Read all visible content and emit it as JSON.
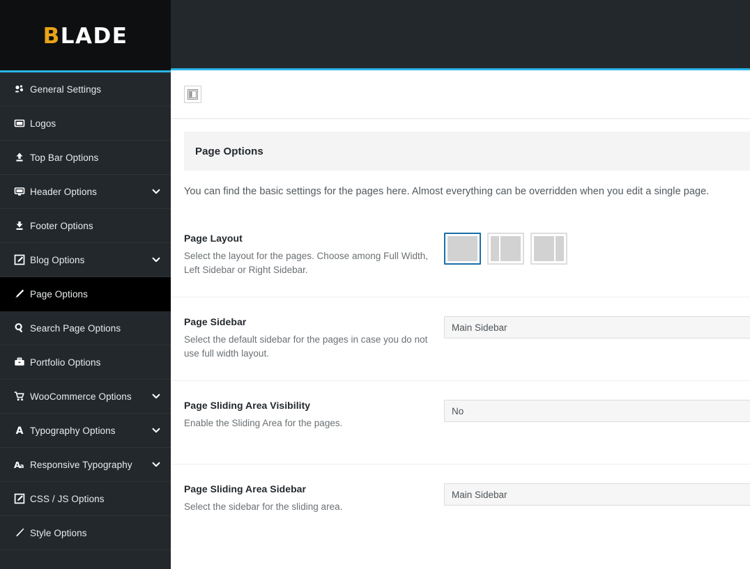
{
  "brand": {
    "logo_first": "B",
    "logo_rest": "LADE",
    "accent_color": "#29b6e8",
    "logo_accent_color": "#e8a317"
  },
  "sidebar": {
    "items": [
      {
        "label": "General Settings",
        "icon": "sliders-icon",
        "expandable": false,
        "active": false
      },
      {
        "label": "Logos",
        "icon": "image-icon",
        "expandable": false,
        "active": false
      },
      {
        "label": "Top Bar Options",
        "icon": "arrow-up-icon",
        "expandable": false,
        "active": false
      },
      {
        "label": "Header Options",
        "icon": "monitor-icon",
        "expandable": true,
        "active": false
      },
      {
        "label": "Footer Options",
        "icon": "arrow-down-icon",
        "expandable": false,
        "active": false
      },
      {
        "label": "Blog Options",
        "icon": "edit-square-icon",
        "expandable": true,
        "active": false
      },
      {
        "label": "Page Options",
        "icon": "pencil-icon",
        "expandable": false,
        "active": true
      },
      {
        "label": "Search Page Options",
        "icon": "search-icon",
        "expandable": false,
        "active": false
      },
      {
        "label": "Portfolio Options",
        "icon": "briefcase-icon",
        "expandable": false,
        "active": false
      },
      {
        "label": "WooCommerce Options",
        "icon": "cart-icon",
        "expandable": true,
        "active": false
      },
      {
        "label": "Typography Options",
        "icon": "letter-a-icon",
        "expandable": true,
        "active": false
      },
      {
        "label": "Responsive Typography",
        "icon": "letter-aa-icon",
        "expandable": true,
        "active": false
      },
      {
        "label": "CSS / JS Options",
        "icon": "code-edit-icon",
        "expandable": false,
        "active": false
      },
      {
        "label": "Style Options",
        "icon": "brush-icon",
        "expandable": false,
        "active": false
      }
    ]
  },
  "toolbar": {
    "layout_toggle_icon": "sidebar-layout-icon"
  },
  "panel": {
    "title": "Page Options",
    "description": "You can find the basic settings for the pages here. Almost everything can be overridden when you edit a single page."
  },
  "fields": [
    {
      "title": "Page Layout",
      "subtitle": "Select the layout for the pages. Choose among Full Width, Left Sidebar or Right Sidebar.",
      "control": "layout-picker",
      "options": [
        {
          "name": "full-width",
          "selected": true
        },
        {
          "name": "left-sidebar",
          "selected": false
        },
        {
          "name": "right-sidebar",
          "selected": false
        }
      ]
    },
    {
      "title": "Page Sidebar",
      "subtitle": "Select the default sidebar for the pages in case you do not use full width layout.",
      "control": "select",
      "value": "Main Sidebar"
    },
    {
      "title": "Page Sliding Area Visibility",
      "subtitle": "Enable the Sliding Area for the pages.",
      "control": "select",
      "value": "No"
    },
    {
      "title": "Page Sliding Area Sidebar",
      "subtitle": "Select the sidebar for the sliding area.",
      "control": "select",
      "value": "Main Sidebar"
    }
  ]
}
